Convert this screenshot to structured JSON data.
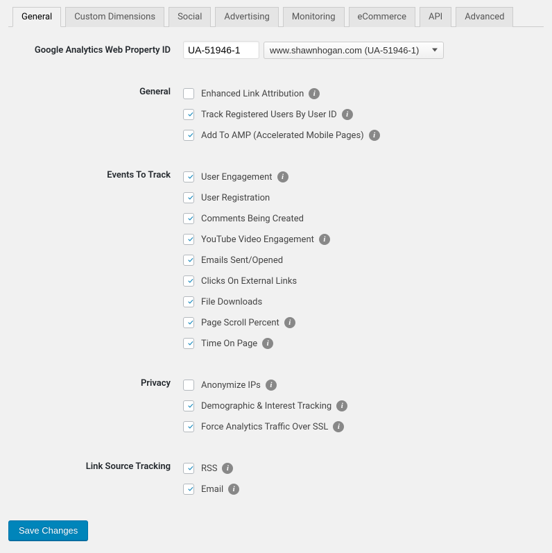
{
  "tabs": [
    {
      "label": "General",
      "active": true
    },
    {
      "label": "Custom Dimensions",
      "active": false
    },
    {
      "label": "Social",
      "active": false
    },
    {
      "label": "Advertising",
      "active": false
    },
    {
      "label": "Monitoring",
      "active": false
    },
    {
      "label": "eCommerce",
      "active": false
    },
    {
      "label": "API",
      "active": false
    },
    {
      "label": "Advanced",
      "active": false
    }
  ],
  "property_id": {
    "label": "Google Analytics Web Property ID",
    "value": "UA-51946-1",
    "select_display": "www.shawnhogan.com (UA-51946-1)"
  },
  "sections": {
    "general": {
      "label": "General",
      "items": [
        {
          "label": "Enhanced Link Attribution",
          "checked": false,
          "info": true
        },
        {
          "label": "Track Registered Users By User ID",
          "checked": true,
          "info": true
        },
        {
          "label": "Add To AMP (Accelerated Mobile Pages)",
          "checked": true,
          "info": true
        }
      ]
    },
    "events": {
      "label": "Events To Track",
      "items": [
        {
          "label": "User Engagement",
          "checked": true,
          "info": true
        },
        {
          "label": "User Registration",
          "checked": true,
          "info": false
        },
        {
          "label": "Comments Being Created",
          "checked": true,
          "info": false
        },
        {
          "label": "YouTube Video Engagement",
          "checked": true,
          "info": true
        },
        {
          "label": "Emails Sent/Opened",
          "checked": true,
          "info": false
        },
        {
          "label": "Clicks On External Links",
          "checked": true,
          "info": false
        },
        {
          "label": "File Downloads",
          "checked": true,
          "info": false
        },
        {
          "label": "Page Scroll Percent",
          "checked": true,
          "info": true
        },
        {
          "label": "Time On Page",
          "checked": true,
          "info": true
        }
      ]
    },
    "privacy": {
      "label": "Privacy",
      "items": [
        {
          "label": "Anonymize IPs",
          "checked": false,
          "info": true
        },
        {
          "label": "Demographic & Interest Tracking",
          "checked": true,
          "info": true
        },
        {
          "label": "Force Analytics Traffic Over SSL",
          "checked": true,
          "info": true
        }
      ]
    },
    "link_source": {
      "label": "Link Source Tracking",
      "items": [
        {
          "label": "RSS",
          "checked": true,
          "info": true
        },
        {
          "label": "Email",
          "checked": true,
          "info": true
        }
      ]
    }
  },
  "save_button": "Save Changes",
  "info_glyph": "i"
}
